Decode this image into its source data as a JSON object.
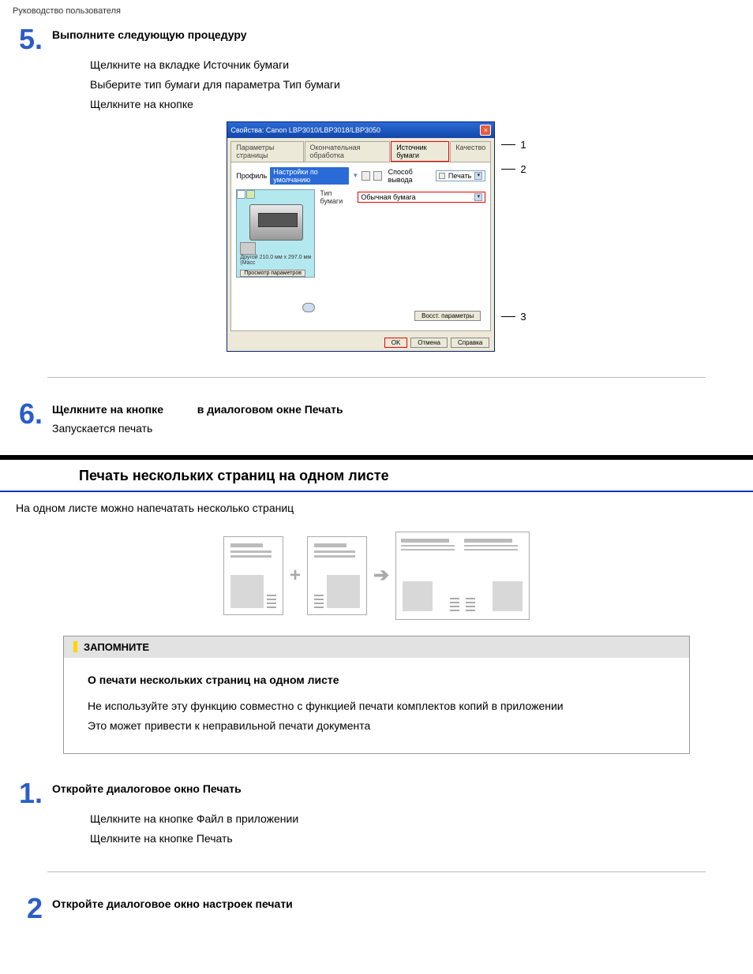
{
  "header": "Руководство пользователя",
  "step5": {
    "num": "5.",
    "title": "Выполните следующую процедуру",
    "p1": "Щелкните на вкладке   Источник бумаги",
    "p2": "Выберите тип бумаги для параметра   Тип бумаги",
    "p3": "Щелкните на кнопке"
  },
  "dlg": {
    "title": "Свойства: Canon LBP3010/LBP3018/LBP3050",
    "close": "×",
    "tab1": "Параметры страницы",
    "tab2": "Окончательная обработка",
    "tab3": "Источник бумаги",
    "tab4": "Качество",
    "profile_lbl": "Профиль",
    "profile_btn": "Настройки по умолчанию",
    "output_lbl": "Способ вывода",
    "output_val": "Печать",
    "type_lbl": "Тип бумаги",
    "type_val": "Обычная бумага",
    "preview_dim": "Другой 210.0 мм x 297.0 мм (Масс",
    "preview_btn": "Просмотр параметров",
    "restore": "Восст. параметры",
    "ok": "OK",
    "cancel": "Отмена",
    "help": "Справка"
  },
  "callout1": "1",
  "callout2": "2",
  "callout3": "3",
  "step6": {
    "num": "6.",
    "title_a": "Щелкните на кнопке",
    "title_b": "в диалоговом окне   Печать",
    "desc": "Запускается печать"
  },
  "section_heading": "Печать нескольких страниц на одном листе",
  "section_intro": "На одном листе можно напечатать несколько страниц",
  "note": {
    "header": "ЗАПОМНИТЕ",
    "sub": "О печати нескольких страниц на одном листе",
    "p1": "Не используйте эту функцию совместно с функцией печати комплектов копий в приложении",
    "p2": "Это может привести к неправильной печати документа"
  },
  "step1": {
    "num": "1.",
    "title": "Откройте диалоговое окно   Печать",
    "p1": "Щелкните на кнопке   Файл   в приложении",
    "p2": "Щелкните на кнопке   Печать"
  },
  "step2": {
    "num": "2",
    "title": "Откройте диалоговое окно настроек печати"
  }
}
